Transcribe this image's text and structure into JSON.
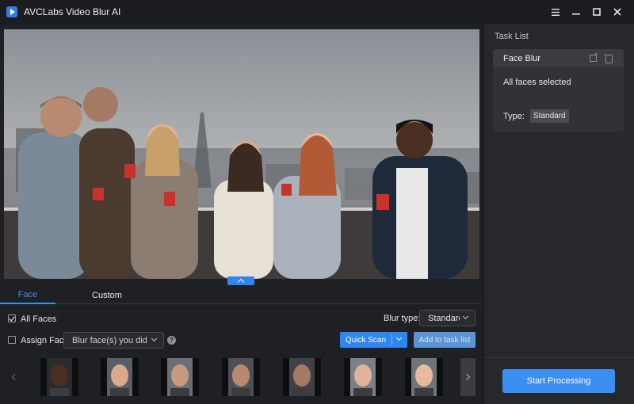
{
  "app": {
    "title": "AVCLabs Video Blur AI",
    "window_controls": [
      "menu-icon",
      "minimize-icon",
      "maximize-icon",
      "close-icon"
    ]
  },
  "tabs": [
    {
      "label": "Face",
      "active": true
    },
    {
      "label": "Custom",
      "active": false
    }
  ],
  "options": {
    "all_faces": {
      "label": "All Faces",
      "checked": true
    },
    "assign_face": {
      "label": "Assign Face",
      "checked": false
    },
    "assign_face_select": "Blur face(s) you did se",
    "blur_type_label": "Blur type:",
    "blur_type_value": "Standard"
  },
  "buttons": {
    "quick_scan": "Quick Scan",
    "add_to_task_list": "Add to task list",
    "start_processing": "Start Processing"
  },
  "task_list": {
    "title": "Task List",
    "tasks": [
      {
        "name": "Face Blur",
        "description": "All faces selected",
        "type_label": "Type:",
        "type_value": "Standard"
      }
    ]
  },
  "thumbnails": [
    {
      "name": "face-thumb-1",
      "skin": "#4a2e22",
      "bg": "#2b2b2e"
    },
    {
      "name": "face-thumb-2",
      "skin": "#d9a98a",
      "bg": "#5a5e66"
    },
    {
      "name": "face-thumb-3",
      "skin": "#c99a80",
      "bg": "#6a6e75"
    },
    {
      "name": "face-thumb-4",
      "skin": "#b98a72",
      "bg": "#4d5157"
    },
    {
      "name": "face-thumb-5",
      "skin": "#a47a64",
      "bg": "#3e4146"
    },
    {
      "name": "face-thumb-6",
      "skin": "#e0b39a",
      "bg": "#7c8088"
    },
    {
      "name": "face-thumb-7",
      "skin": "#e6b9a0",
      "bg": "#6f737a"
    }
  ],
  "colors": {
    "accent": "#2e86f0",
    "panel": "#27282c",
    "background": "#1f2023"
  }
}
